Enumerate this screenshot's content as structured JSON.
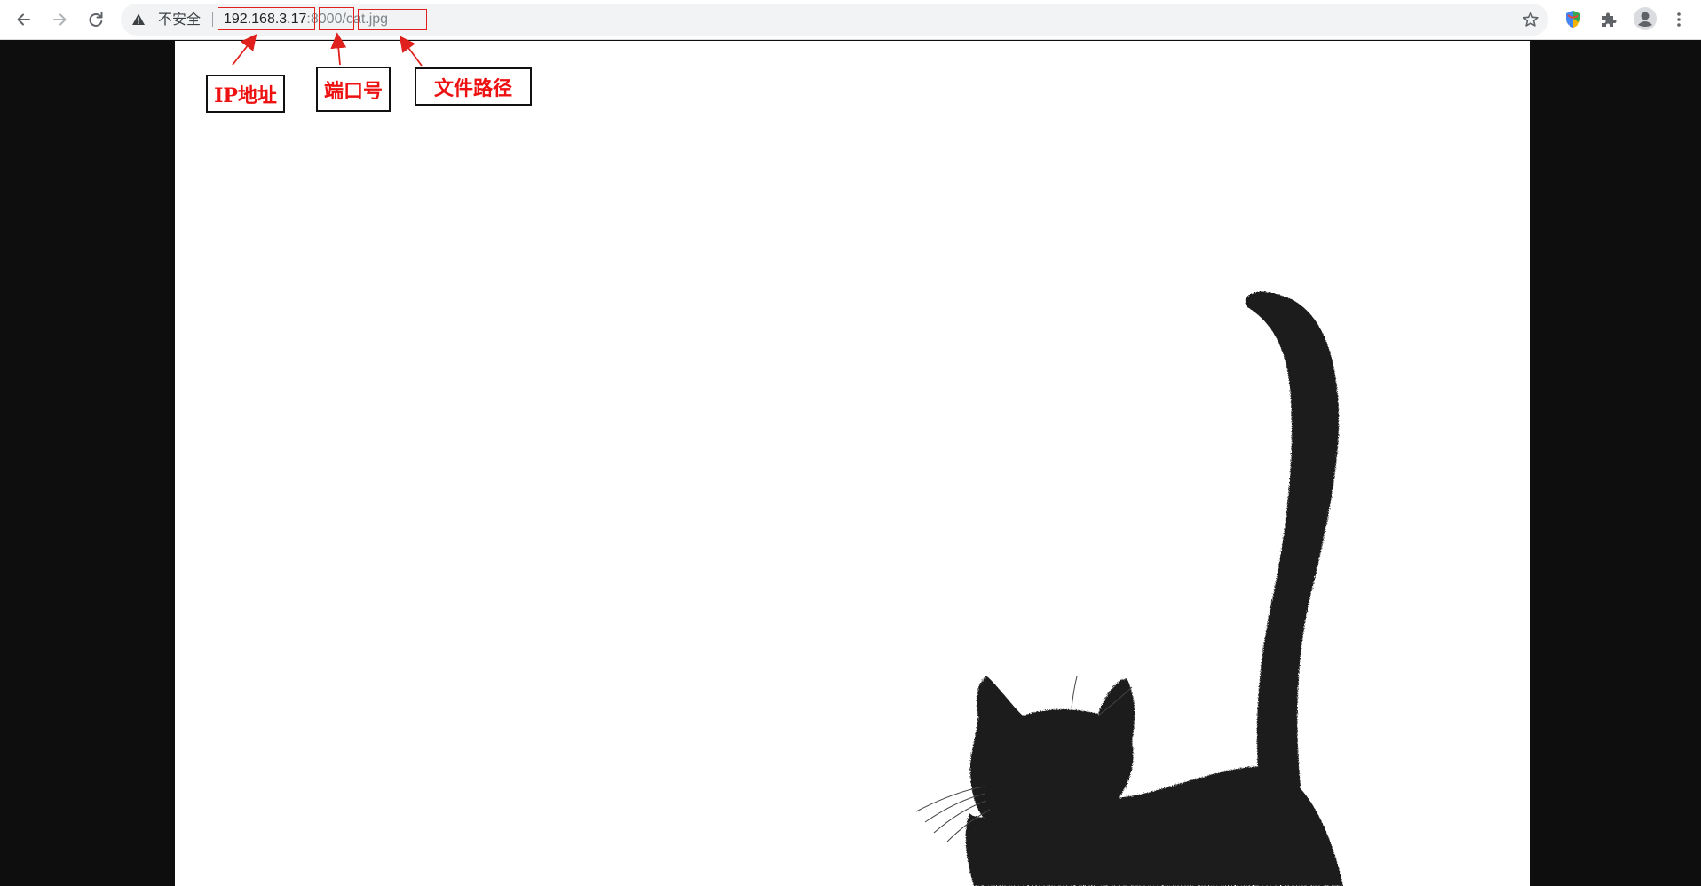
{
  "omnibox": {
    "security_text": "不安全",
    "url_host": "192.168.3.17",
    "url_port_sep": ":",
    "url_port": "8000",
    "url_path_sep": "/",
    "url_path": "cat.jpg"
  },
  "annotations": {
    "ip_label": "IP地址",
    "port_label": "端口号",
    "path_label": "文件路径",
    "highlight_color": "#e0201c",
    "label_text_color": "#ee1111"
  },
  "icons": {
    "back": "back-arrow-icon",
    "forward": "forward-arrow-icon",
    "reload": "reload-icon",
    "warning": "warning-triangle-icon",
    "bookmark": "star-icon",
    "extension_app": "colorful-shield-icon",
    "extensions": "puzzle-piece-icon",
    "profile": "user-avatar-icon",
    "menu": "three-dots-menu-icon"
  },
  "content": {
    "image_subject": "cat.jpg"
  }
}
